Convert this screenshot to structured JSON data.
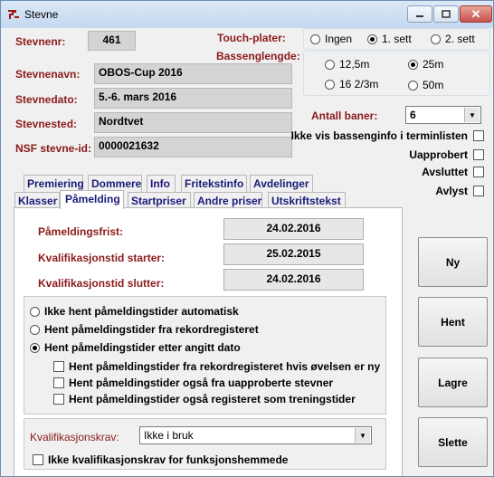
{
  "window": {
    "title": "Stevne",
    "close_symbol": "✕"
  },
  "header": {
    "stevnenr_label": "Stevnenr:",
    "stevnenr_value": "461",
    "stevnenavn_label": "Stevnenavn:",
    "stevnenavn_value": "OBOS-Cup 2016",
    "stevnedato_label": "Stevnedato:",
    "stevnedato_value": "5.-6. mars 2016",
    "stevnested_label": "Stevnested:",
    "stevnested_value": "Nordtvet",
    "nsf_label": "NSF stevne-id:",
    "nsf_value": "0000021632"
  },
  "touch": {
    "label": "Touch-plater:",
    "options": [
      "Ingen",
      "1. sett",
      "2. sett"
    ],
    "selected": 1
  },
  "basseng": {
    "label": "Bassenglengde:",
    "options": [
      "12,5m",
      "25m",
      "16 2/3m",
      "50m"
    ],
    "selected": 1
  },
  "baner": {
    "label": "Antall baner:",
    "value": "6"
  },
  "flags": [
    "Ikke vis bassenginfo i terminlisten",
    "Uapprobert",
    "Avsluttet",
    "Avlyst"
  ],
  "tabs_row1": [
    "Premiering",
    "Dommere",
    "Info",
    "Fritekstinfo",
    "Avdelinger"
  ],
  "tabs_row2": [
    "Klasser",
    "Påmelding",
    "Startpriser",
    "Andre priser",
    "Utskriftstekst"
  ],
  "active_tab": "Påmelding",
  "pamelding": {
    "frist_label": "Påmeldingsfrist:",
    "frist_value": "24.02.2016",
    "kval_start_label": "Kvalifikasjonstid starter:",
    "kval_start_value": "25.02.2015",
    "kval_slutt_label": "Kvalifikasjonstid slutter:",
    "kval_slutt_value": "24.02.2016",
    "radio_options": [
      "Ikke hent påmeldingstider automatisk",
      "Hent påmeldingstider fra rekordregisteret",
      "Hent påmeldingstider etter angitt dato"
    ],
    "radio_selected": 2,
    "sub_checks": [
      "Hent påmeldingstider fra rekordregisteret hvis øvelsen er ny",
      "Hent påmeldingstider også fra uapproberte stevner",
      "Hent påmeldingstider også registeret som treningstider"
    ],
    "kvalkrav_label": "Kvalifikasjonskrav:",
    "kvalkrav_value": "Ikke i bruk",
    "funksjon_label": "Ikke kvalifikasjonskrav for funksjonshemmede"
  },
  "buttons": {
    "ny": "Ny",
    "hent": "Hent",
    "lagre": "Lagre",
    "slette": "Slette"
  }
}
